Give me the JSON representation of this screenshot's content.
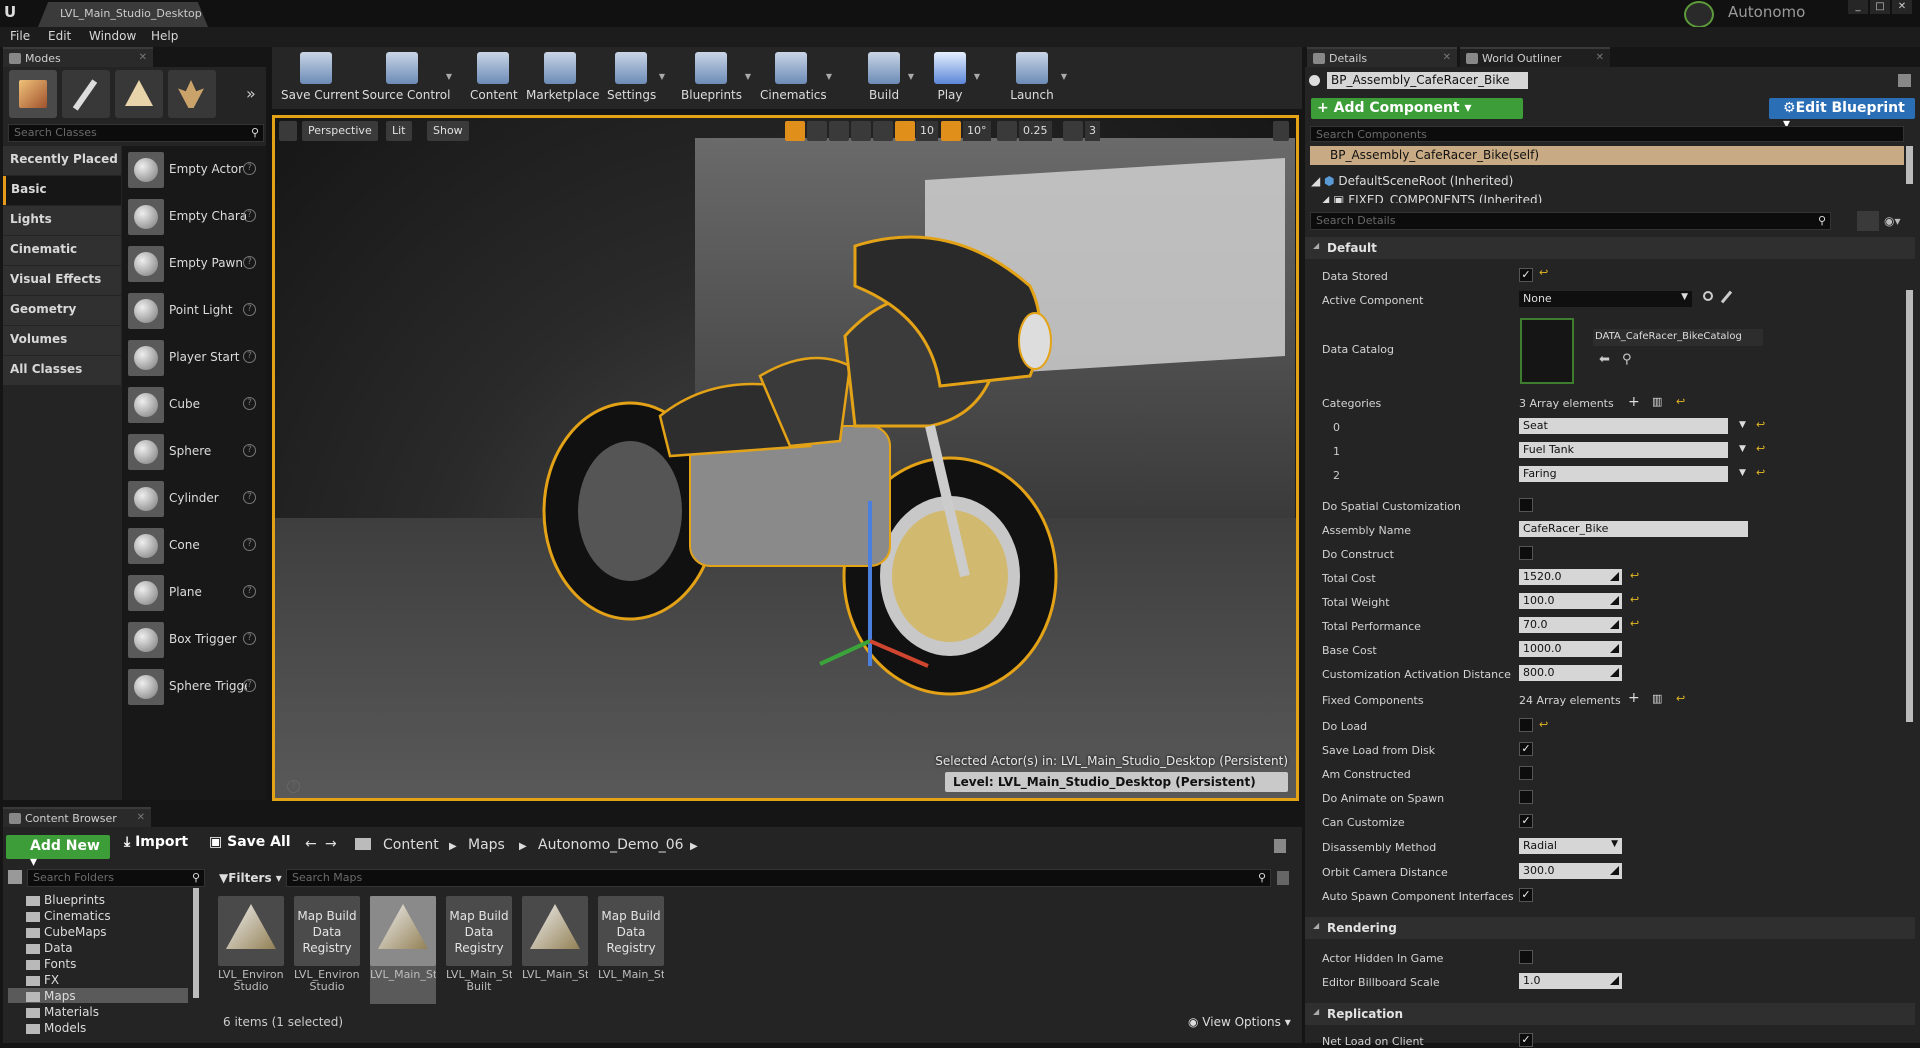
{
  "title_bar": {
    "document_tab": "LVL_Main_Studio_Desktop",
    "project_name": "Autonomo",
    "window_buttons": [
      "minimize-icon",
      "maximize-icon",
      "close-icon"
    ]
  },
  "menu": [
    "File",
    "Edit",
    "Window",
    "Help"
  ],
  "modes": {
    "tab_label": "Modes",
    "mode_icons": [
      "place-mode-icon",
      "paint-mode-icon",
      "landscape-mode-icon",
      "foliage-mode-icon"
    ],
    "search_placeholder": "Search Classes",
    "categories": [
      "Recently Placed",
      "Basic",
      "Lights",
      "Cinematic",
      "Visual Effects",
      "Geometry",
      "Volumes",
      "All Classes"
    ],
    "selected_category": "Basic",
    "items": [
      "Empty Actor",
      "Empty Character",
      "Empty Pawn",
      "Point Light",
      "Player Start",
      "Cube",
      "Sphere",
      "Cylinder",
      "Cone",
      "Plane",
      "Box Trigger",
      "Sphere Trigger"
    ]
  },
  "toolbar": {
    "buttons": [
      "Save Current",
      "Source Control",
      "Content",
      "Marketplace",
      "Settings",
      "Blueprints",
      "Cinematics",
      "Build",
      "Play",
      "Launch"
    ]
  },
  "viewport": {
    "perspective_label": "Perspective",
    "lit_label": "Lit",
    "show_label": "Show",
    "grid_snap": "10",
    "rotation_snap": "10°",
    "scale_snap": "0.25",
    "camera_speed": "3",
    "selected_actor_text": "Selected Actor(s) in:  LVL_Main_Studio_Desktop (Persistent)",
    "level_text": "Level:  LVL_Main_Studio_Desktop (Persistent)"
  },
  "content_browser": {
    "tab_label": "Content Browser",
    "add_new": "Add New",
    "import": "Import",
    "save_all": "Save All",
    "breadcrumbs": [
      "Content",
      "Maps",
      "Autonomo_Demo_06"
    ],
    "search_folders": "Search Folders",
    "filters": "Filters",
    "search_maps": "Search Maps",
    "folders": [
      "Blueprints",
      "Cinematics",
      "CubeMaps",
      "Data",
      "Fonts",
      "FX",
      "Maps",
      "Materials",
      "Models"
    ],
    "selected_folder": "Maps",
    "assets": [
      {
        "thumb": "map",
        "thumb_label": "",
        "name": "LVL_Environment_Static Studio"
      },
      {
        "thumb": "registry",
        "thumb_label": "Map Build Data Registry",
        "name": "LVL_Environment_Static Studio"
      },
      {
        "thumb": "map",
        "thumb_label": "",
        "name": "LVL_Main_Studio_Desktop"
      },
      {
        "thumb": "registry",
        "thumb_label": "Map Build Data Registry",
        "name": "LVL_Main_Studio_Desktop Built"
      },
      {
        "thumb": "map",
        "thumb_label": "",
        "name": "LVL_Main_Studio_VR"
      },
      {
        "thumb": "registry",
        "thumb_label": "Map Build Data Registry",
        "name": "LVL_Main_Studio_VR_BuiltData"
      }
    ],
    "selected_asset_index": 2,
    "item_count": "6 items (1 selected)",
    "view_options": "View Options"
  },
  "details": {
    "tab_details": "Details",
    "tab_outliner": "World Outliner",
    "actor_name": "BP_Assembly_CafeRacer_Bike",
    "add_component": "+ Add Component",
    "edit_blueprint": "Edit Blueprint",
    "search_components": "Search Components",
    "components": [
      "BP_Assembly_CafeRacer_Bike(self)",
      "DefaultSceneRoot (Inherited)",
      "FIXED_COMPONENTS (Inherited)"
    ],
    "search_details": "Search Details",
    "default_section": "Default",
    "properties_a": [
      {
        "label": "Data Stored",
        "type": "check",
        "checked": true
      },
      {
        "label": "Active Component",
        "type": "dropdown",
        "value": "None"
      }
    ],
    "data_catalog_label": "Data Catalog",
    "data_catalog_value": "DATA_CafeRacer_BikeCatalog",
    "categories_label": "Categories",
    "categories_count": "3 Array elements",
    "categories": [
      {
        "index": "0",
        "value": "Seat"
      },
      {
        "index": "1",
        "value": "Fuel Tank"
      },
      {
        "index": "2",
        "value": "Faring"
      }
    ],
    "properties_b": [
      {
        "label": "Do Spatial Customization",
        "type": "check",
        "checked": false
      },
      {
        "label": "Assembly Name",
        "type": "text",
        "value": "CafeRacer_Bike"
      },
      {
        "label": "Do Construct",
        "type": "check",
        "checked": false
      },
      {
        "label": "Total Cost",
        "type": "num",
        "value": "1520.0",
        "reset": true
      },
      {
        "label": "Total Weight",
        "type": "num",
        "value": "100.0",
        "reset": true
      },
      {
        "label": "Total Performance",
        "type": "num",
        "value": "70.0",
        "reset": true
      },
      {
        "label": "Base Cost",
        "type": "num",
        "value": "1000.0",
        "reset": false
      },
      {
        "label": "Customization Activation Distance",
        "type": "num",
        "value": "800.0",
        "reset": false
      }
    ],
    "fixed_components_label": "Fixed Components",
    "fixed_components_count": "24 Array elements",
    "properties_c": [
      {
        "label": "Do Load",
        "type": "check",
        "checked": false,
        "reset": true
      },
      {
        "label": "Save Load from Disk",
        "type": "check",
        "checked": true
      },
      {
        "label": "Am Constructed",
        "type": "check",
        "checked": false
      },
      {
        "label": "Do Animate on Spawn",
        "type": "check",
        "checked": false
      },
      {
        "label": "Can Customize",
        "type": "check",
        "checked": true
      },
      {
        "label": "Disassembly Method",
        "type": "dropdown",
        "value": "Radial"
      },
      {
        "label": "Orbit Camera Distance",
        "type": "num",
        "value": "300.0"
      },
      {
        "label": "Auto Spawn Component Interfaces",
        "type": "check",
        "checked": true
      }
    ],
    "rendering_section": "Rendering",
    "rendering": [
      {
        "label": "Actor Hidden In Game",
        "type": "check",
        "checked": false
      },
      {
        "label": "Editor Billboard Scale",
        "type": "num",
        "value": "1.0"
      }
    ],
    "replication_section": "Replication",
    "replication": [
      {
        "label": "Net Load on Client",
        "type": "check",
        "checked": true
      }
    ]
  },
  "colors": {
    "selection_outline": "#e4a317",
    "add_green": "#3d9d38",
    "edit_blueprint_blue": "#2a6fb6",
    "reset_arrow": "#e2b623"
  }
}
